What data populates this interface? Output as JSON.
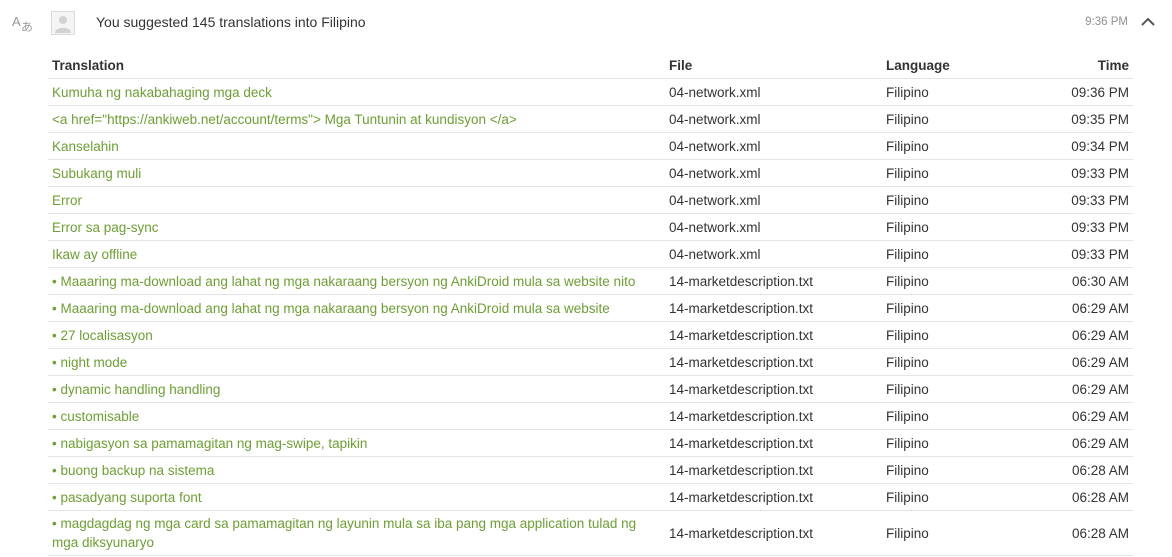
{
  "header": {
    "headline": "You suggested 145 translations into Filipino",
    "time": "9:36 PM"
  },
  "columns": {
    "translation": "Translation",
    "file": "File",
    "language": "Language",
    "time": "Time"
  },
  "rows": [
    {
      "translation": "Kumuha ng nakabahaging mga deck",
      "file": "04-network.xml",
      "language": "Filipino",
      "time": "09:36 PM"
    },
    {
      "translation": "<a href=\"https://ankiweb.net/account/terms\"> Mga Tuntunin at kundisyon </a>",
      "file": "04-network.xml",
      "language": "Filipino",
      "time": "09:35 PM"
    },
    {
      "translation": "Kanselahin",
      "file": "04-network.xml",
      "language": "Filipino",
      "time": "09:34 PM"
    },
    {
      "translation": "Subukang muli",
      "file": "04-network.xml",
      "language": "Filipino",
      "time": "09:33 PM"
    },
    {
      "translation": "Error",
      "file": "04-network.xml",
      "language": "Filipino",
      "time": "09:33 PM"
    },
    {
      "translation": "Error sa pag-sync",
      "file": "04-network.xml",
      "language": "Filipino",
      "time": "09:33 PM"
    },
    {
      "translation": "Ikaw ay offline",
      "file": "04-network.xml",
      "language": "Filipino",
      "time": "09:33 PM"
    },
    {
      "translation": "• Maaaring ma-download ang lahat ng mga nakaraang bersyon ng AnkiDroid mula sa website nito",
      "file": "14-marketdescription.txt",
      "language": "Filipino",
      "time": "06:30 AM"
    },
    {
      "translation": "• Maaaring ma-download ang lahat ng mga nakaraang bersyon ng AnkiDroid mula sa website",
      "file": "14-marketdescription.txt",
      "language": "Filipino",
      "time": "06:29 AM"
    },
    {
      "translation": "• 27 localisasyon",
      "file": "14-marketdescription.txt",
      "language": "Filipino",
      "time": "06:29 AM"
    },
    {
      "translation": "• night mode",
      "file": "14-marketdescription.txt",
      "language": "Filipino",
      "time": "06:29 AM"
    },
    {
      "translation": "• dynamic handling handling",
      "file": "14-marketdescription.txt",
      "language": "Filipino",
      "time": "06:29 AM"
    },
    {
      "translation": "• customisable",
      "file": "14-marketdescription.txt",
      "language": "Filipino",
      "time": "06:29 AM"
    },
    {
      "translation": "• nabigasyon sa pamamagitan ng mag-swipe, tapikin",
      "file": "14-marketdescription.txt",
      "language": "Filipino",
      "time": "06:29 AM"
    },
    {
      "translation": "• buong backup na sistema",
      "file": "14-marketdescription.txt",
      "language": "Filipino",
      "time": "06:28 AM"
    },
    {
      "translation": "• pasadyang suporta font",
      "file": "14-marketdescription.txt",
      "language": "Filipino",
      "time": "06:28 AM"
    },
    {
      "translation": "• magdagdag ng mga card sa pamamagitan ng layunin mula sa iba pang mga application tulad ng mga diksyunaryo",
      "file": "14-marketdescription.txt",
      "language": "Filipino",
      "time": "06:28 AM"
    }
  ]
}
